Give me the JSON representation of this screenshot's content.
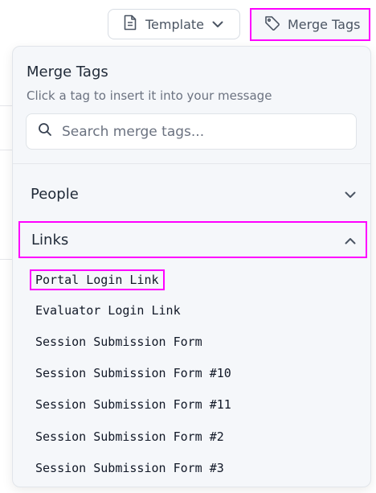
{
  "toolbar": {
    "template_label": "Template",
    "merge_tags_label": "Merge Tags"
  },
  "popover": {
    "title": "Merge Tags",
    "subtitle": "Click a tag to insert it into your message",
    "search_placeholder": "Search merge tags...",
    "sections": [
      {
        "label": "People",
        "expanded": false
      },
      {
        "label": "Links",
        "expanded": true
      }
    ],
    "link_tags": [
      "Portal Login Link",
      "Evaluator Login Link",
      "Session Submission Form",
      "Session Submission Form #10",
      "Session Submission Form #11",
      "Session Submission Form #2",
      "Session Submission Form #3"
    ]
  },
  "colors": {
    "highlight": "#ff00ff",
    "popover_bg": "#f5f7fa",
    "text": "#1f2937",
    "muted_text": "#6b7280"
  }
}
